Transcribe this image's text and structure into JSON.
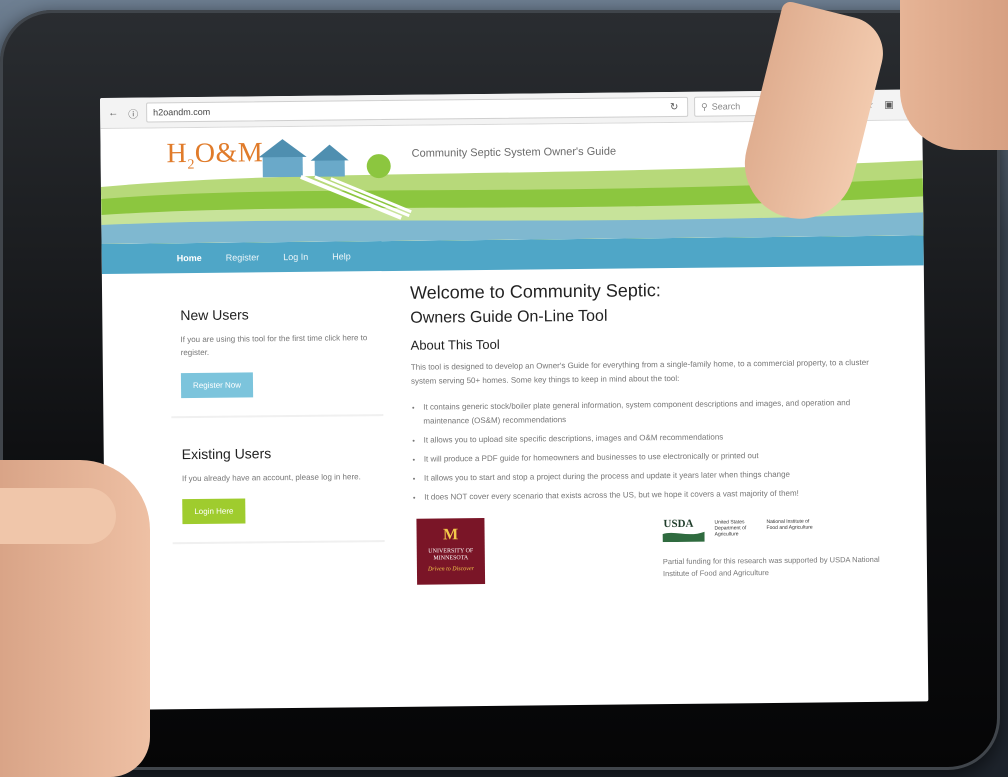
{
  "browser": {
    "url": "h2oandm.com",
    "search_placeholder": "Search"
  },
  "site": {
    "logo_text": "H",
    "logo_sub": "2",
    "logo_tail": "O&M",
    "tagline": "Community Septic System Owner's Guide"
  },
  "nav": {
    "items": [
      "Home",
      "Register",
      "Log In",
      "Help"
    ]
  },
  "sidebar": {
    "new_users": {
      "title": "New Users",
      "text": "If you are using this tool for the first time click here to register.",
      "button": "Register Now"
    },
    "existing_users": {
      "title": "Existing Users",
      "text": "If you already have an account, please log in here.",
      "button": "Login Here"
    }
  },
  "main": {
    "title": "Welcome to Community Septic:",
    "subtitle": "Owners Guide On-Line Tool",
    "section_heading": "About This Tool",
    "intro": "This tool is designed to develop an Owner's Guide for everything from a single-family home, to a commercial property, to a cluster system serving 50+ homes. Some key things to keep in mind about the tool:",
    "bullets": [
      "It contains generic stock/boiler plate general information, system component descriptions and images, and operation and maintenance (OS&M) recommendations",
      "It allows you to upload site specific descriptions, images and O&M recommendations",
      "It will produce a PDF guide for homeowners and businesses to use electronically or printed out",
      "It allows you to start and stop a project during the process and update it years later when things change",
      "It does NOT cover every scenario that exists across the US, but we hope it covers a vast majority of them!"
    ]
  },
  "logos": {
    "umn_mark": "M",
    "umn_text": "UNIVERSITY OF MINNESOTA",
    "umn_tagline": "Driven to Discover",
    "usda_mark": "USDA",
    "usda_text_1": "United States Department of Agriculture",
    "usda_text_2": "National Institute of Food and Agriculture",
    "funding": "Partial funding for this research was supported by USDA National Institute of Food and Agriculture"
  }
}
